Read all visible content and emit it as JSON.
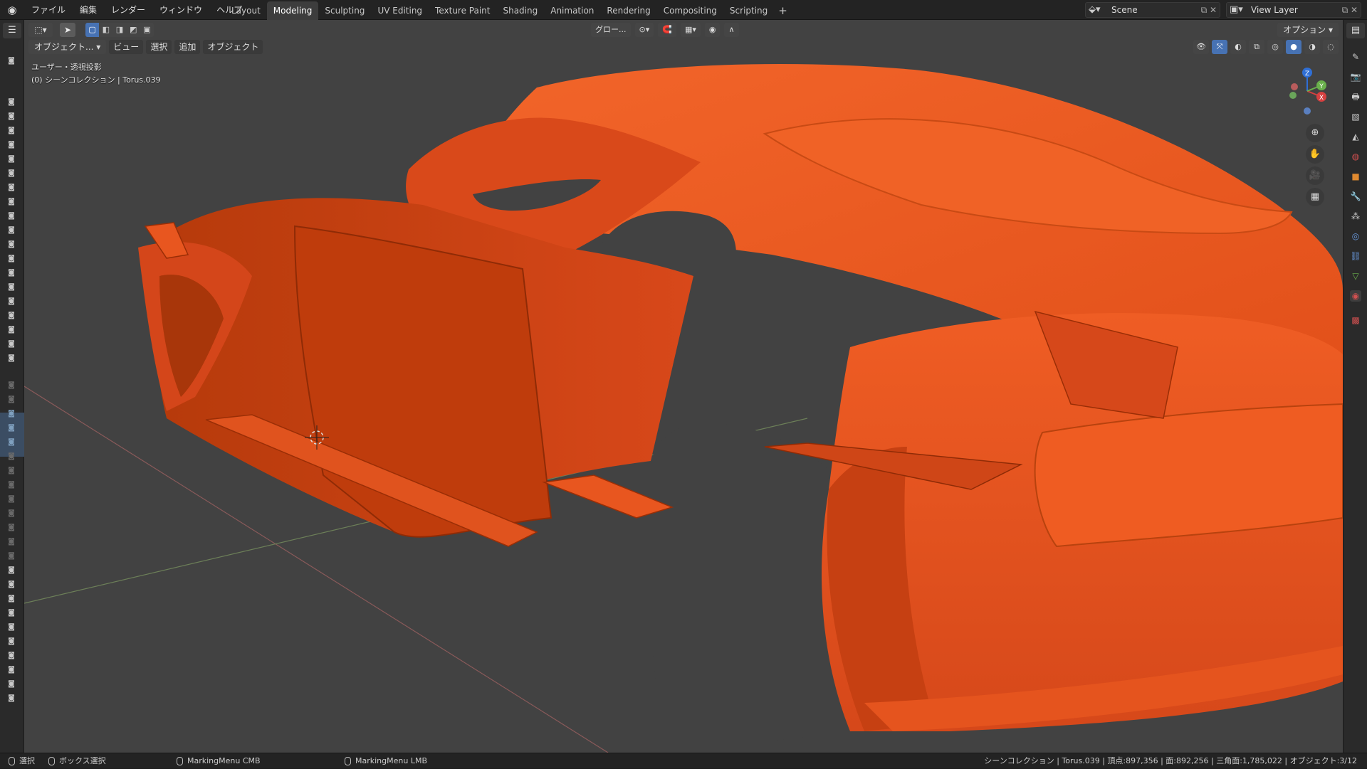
{
  "topbar": {
    "menu": [
      "ファイル",
      "編集",
      "レンダー",
      "ウィンドウ",
      "ヘルプ"
    ],
    "tabs": [
      "Layout",
      "Modeling",
      "Sculpting",
      "UV Editing",
      "Texture Paint",
      "Shading",
      "Animation",
      "Rendering",
      "Compositing",
      "Scripting"
    ],
    "active_tab": "Modeling",
    "add_tab": "+",
    "scene": "Scene",
    "view_layer": "View Layer"
  },
  "viewport": {
    "mode": "オブジェクト...",
    "menus": [
      "ビュー",
      "選択",
      "追加",
      "オブジェクト"
    ],
    "transform_orientation": "グロー...",
    "options": "オプション",
    "view_name": "ユーザー・透視投影",
    "collection_info": "(0) シーンコレクション | Torus.039",
    "gizmo": {
      "z": "Z",
      "x": "X",
      "y": "Y"
    }
  },
  "statusbar": {
    "select": "選択",
    "box_select": "ボックス選択",
    "marking_cmb": "MarkingMenu CMB",
    "marking_lmb": "MarkingMenu LMB",
    "stats": "シーンコレクション | Torus.039 | 頂点:897,356 | 面:892,256 | 三角面:1,785,022 | オブジェクト:3/12"
  },
  "colors": {
    "model": "#e8501a",
    "model_dark": "#a83208",
    "accent": "#4772b3",
    "background": "#424242"
  }
}
